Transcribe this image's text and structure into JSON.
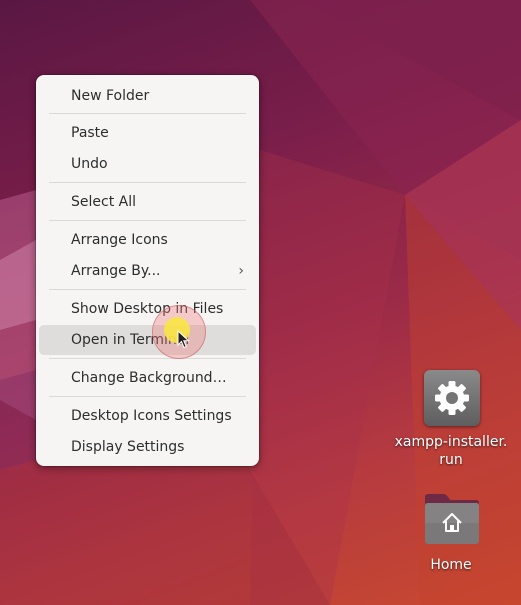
{
  "context_menu": {
    "items": [
      {
        "label": "New Folder"
      },
      {
        "label": "Paste"
      },
      {
        "label": "Undo"
      },
      {
        "label": "Select All"
      },
      {
        "label": "Arrange Icons"
      },
      {
        "label": "Arrange By..."
      },
      {
        "label": "Show Desktop in Files"
      },
      {
        "label": "Open in Terminal"
      },
      {
        "label": "Change Background…"
      },
      {
        "label": "Desktop Icons Settings"
      },
      {
        "label": "Display Settings"
      }
    ],
    "submenu_indicator": "›",
    "hovered_item": "Open in Terminal"
  },
  "desktop_icons": [
    {
      "label_line1": "xampp-installer.",
      "label_line2": "run",
      "icon": "gear-icon"
    },
    {
      "label": "Home",
      "icon": "home-folder-icon"
    }
  ],
  "colors": {
    "menu_background": "#f6f5f4",
    "menu_hover": "#dedddb",
    "wallpaper_top": "#5a1743",
    "wallpaper_bottom": "#c9492f"
  }
}
